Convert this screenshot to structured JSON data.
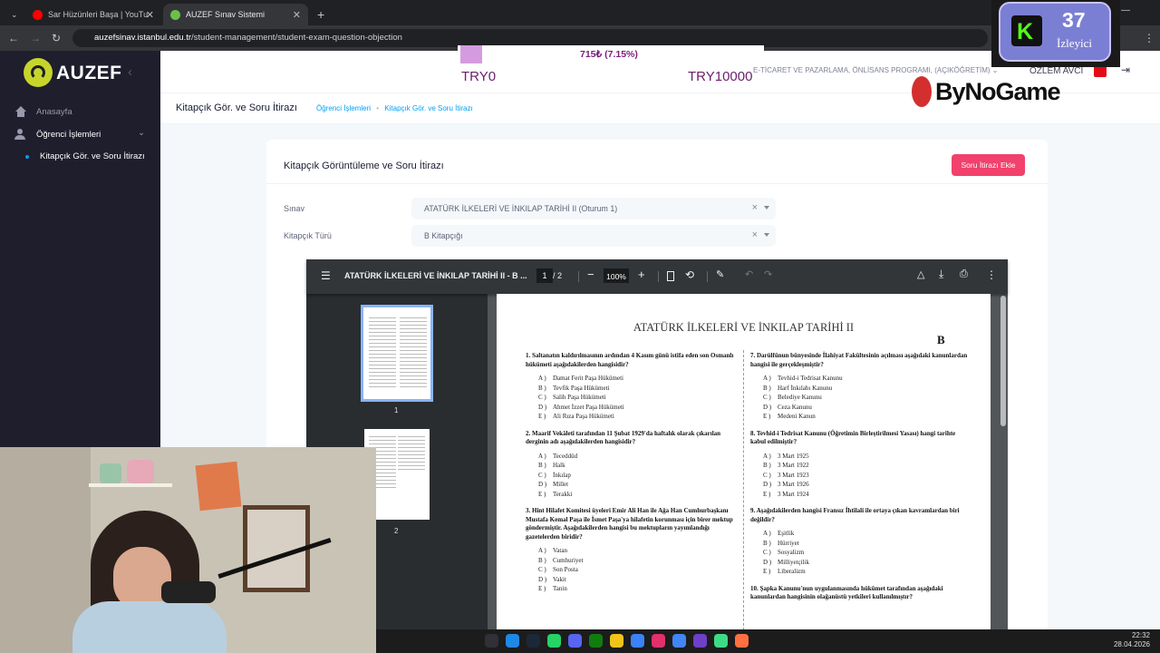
{
  "browser": {
    "tabs": [
      {
        "title": "Sar Hüzünleri Başa | YouTube"
      },
      {
        "title": "AUZEF Sınav Sistemi"
      }
    ],
    "url_host": "auzefsinav.istanbul.edu.tr",
    "url_path": "/student-management/student-exam-question-objection"
  },
  "sidebar": {
    "logo": "AUZEF",
    "items": [
      {
        "label": "Anasayfa"
      },
      {
        "label": "Öğrenci İşlemleri"
      },
      {
        "label": "Kitapçık Gör. ve Soru İtirazı"
      }
    ]
  },
  "header": {
    "program": "E-TİCARET VE PAZARLAMA, ÖNLİSANS PROGRAMI, (AÇIKÖĞRETİM)",
    "user": "ÖZLEM AVCI"
  },
  "subheader": {
    "title": "Kitapçık Gör. ve Soru İtirazı",
    "breadcrumb": [
      "Öğrenci İşlemleri",
      "Kitapçık Gör. ve Soru İtirazı"
    ]
  },
  "card": {
    "title": "Kitapçık Görüntüleme ve Soru İtirazı",
    "add_button": "Soru İtirazı Ekle",
    "exam_label": "Sınav",
    "exam_value": "ATATÜRK İLKELERİ VE İNKILAP TARİHİ II (Oturum 1)",
    "booklet_label": "Kitapçık Türü",
    "booklet_value": "B Kitapçığı"
  },
  "pdf": {
    "title": "ATATÜRK İLKELERİ VE İNKILAP TARİHİ II - B ...",
    "page": "1",
    "pages": "/ 2",
    "zoom": "100%",
    "thumb_labels": [
      "1",
      "2"
    ],
    "doc_title": "ATATÜRK İLKELERİ VE İNKILAP TARİHİ II",
    "booklet_letter": "B",
    "questions_left": [
      {
        "title": "1.  Saltanatın kaldırılmasının ardından 4 Kasım günü istifa eden son Osmanlı hükümeti aşağıdakilerden hangisidir?",
        "options": [
          "Damat Ferit Paşa Hükümeti",
          "Tevfik Paşa Hükümeti",
          "Salih Paşa Hükümeti",
          "Ahmet İzzet Paşa Hükümeti",
          "Ali Rıza Paşa Hükümeti"
        ]
      },
      {
        "title": "2.  Maarif Vekâleti tarafından 11 Şubat 1929'da haftalık olarak çıkarılan derginin adı aşağıdakilerden hangisidir?",
        "options": [
          "Teceddüd",
          "Halk",
          "İnkılap",
          "Millet",
          "Terakki"
        ]
      },
      {
        "title": "3.  Hint Hilafet Komitesi üyeleri Emir Ali Han ile Ağa Han Cumhurbaşkanı Mustafa Kemal Paşa ile İsmet Paşa'ya hilafetin korunması için birer mektup göndermiştir. Aşağıdakilerden hangisi bu mektupların yayımlandığı gazetelerden biridir?",
        "options": [
          "Vatan",
          "Cumhuriyet",
          "Son Posta",
          "Vakit",
          "Tanin"
        ]
      }
    ],
    "questions_right": [
      {
        "title": "7.  Darülfünun bünyesinde İlahiyat Fakültesinin açılması aşağıdaki kanunlardan hangisi ile gerçekleşmiştir?",
        "options": [
          "Tevhid-i Tedrisat Kanunu",
          "Harf İnkılabı Kanunu",
          "Belediye Kanunu",
          "Ceza Kanunu",
          "Medeni Kanun"
        ]
      },
      {
        "title": "8.  Tevhid-i Tedrisat Kanunu (Öğretimin Birleştirilmesi Yasası) hangi tarihte kabul edilmiştir?",
        "options": [
          "3 Mart 1925",
          "3 Mart 1922",
          "3 Mart 1923",
          "3 Mart 1926",
          "3 Mart 1924"
        ]
      },
      {
        "title": "9.  Aşağıdakilerden hangisi Fransız İhtilali ile ortaya çıkan kavramlardan biri değildir?",
        "options": [
          "Eşitlik",
          "Hürriyet",
          "Sosyalizm",
          "Milliyetçilik",
          "Liberalizm"
        ]
      },
      {
        "title": "10. Şapka Kanunu'nun uygulanmasında hükûmet tarafından aşağıdaki kanunlardan hangisinin olağanüstü yetkileri kullanılmıştır?",
        "options": []
      }
    ],
    "letters": [
      "A )",
      "B )",
      "C )",
      "D )",
      "E )"
    ]
  },
  "overlay": {
    "goal_left": "TRY0",
    "goal_right": "TRY10000",
    "goal_progress": "715₺ (7.15%)",
    "goal_fraction": 0.0715,
    "sponsor": "ByNoGame",
    "viewers": "37",
    "viewers_label": "İzleyici"
  },
  "taskbar": {
    "time": "22:32",
    "date": "28.04.2026"
  },
  "colors": {
    "accent": "#009ef7",
    "danger": "#f1416c",
    "sidebar": "#1e1e2d",
    "kick_green": "#53fc18"
  }
}
